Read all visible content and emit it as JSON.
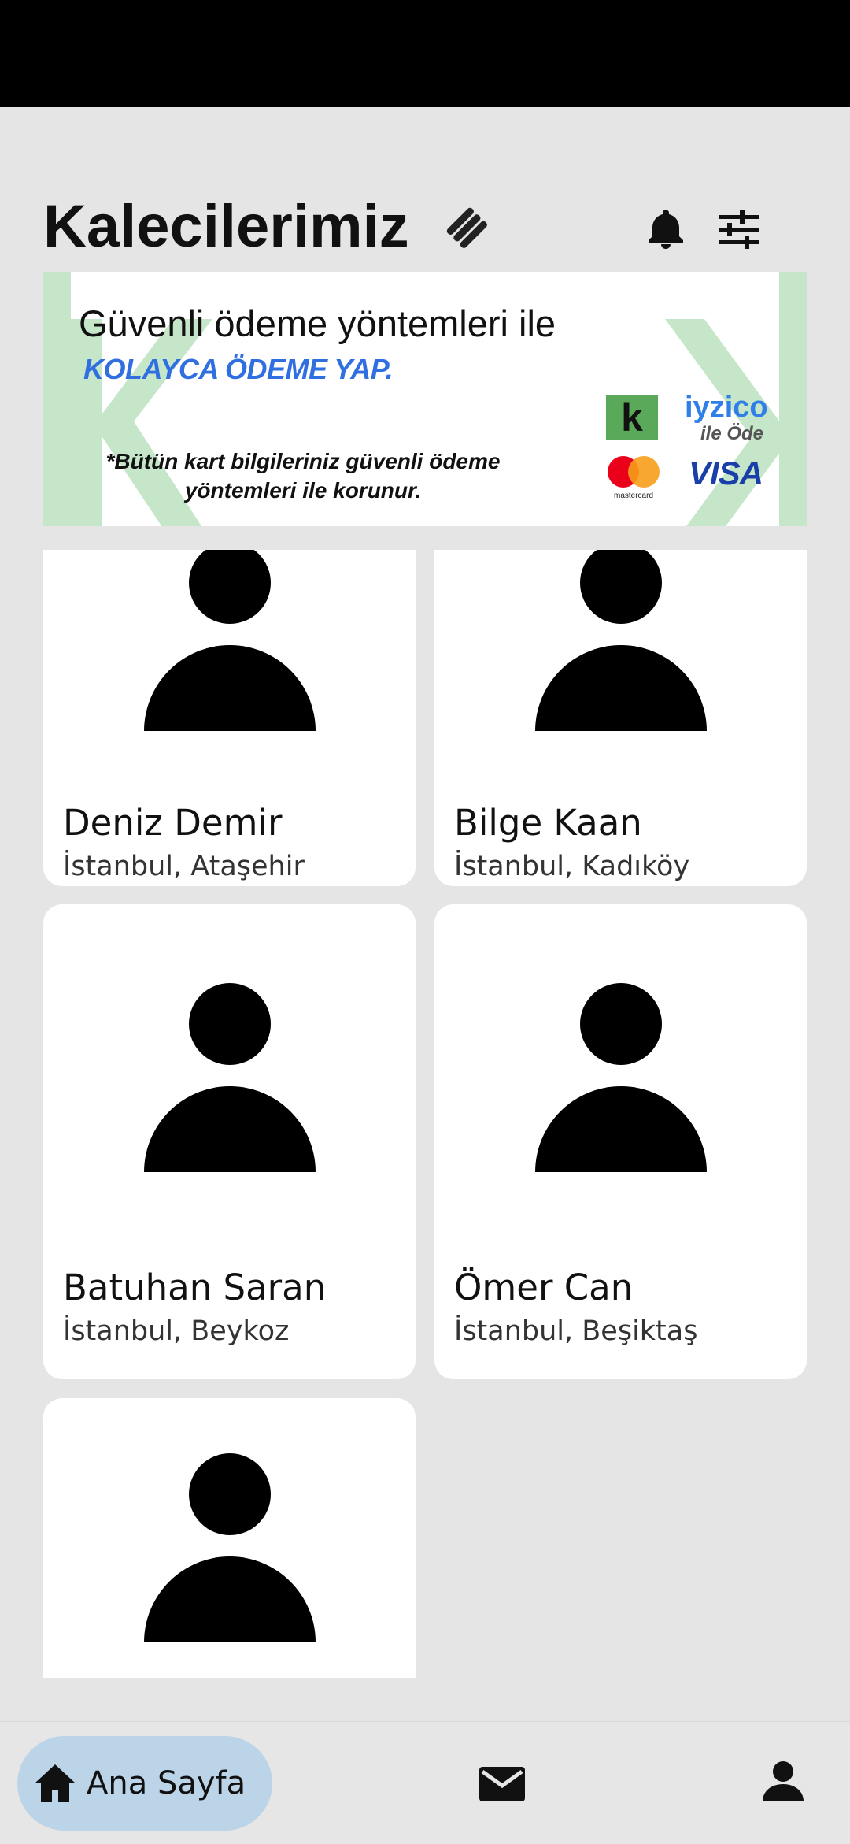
{
  "header": {
    "title": "Kalecilerimiz"
  },
  "banner": {
    "line1": "Güvenli ödeme yöntemleri ile",
    "line2": "KOLAYCA ÖDEME YAP.",
    "note": "*Bütün kart bilgileriniz güvenli ödeme yöntemleri ile korunur.",
    "logo_k": "k",
    "iyzico": "iyzico",
    "ile_ode": "ile Öde",
    "visa": "VISA",
    "mastercard": "mastercard"
  },
  "goalkeepers": [
    {
      "name": "Deniz Demir",
      "location": "İstanbul, Ataşehir"
    },
    {
      "name": "Bilge Kaan",
      "location": "İstanbul, Kadıköy"
    },
    {
      "name": "Batuhan Saran",
      "location": "İstanbul, Beykoz"
    },
    {
      "name": "Ömer Can",
      "location": "İstanbul, Beşiktaş"
    },
    {
      "name": "",
      "location": ""
    }
  ],
  "nav": {
    "home_label": "Ana Sayfa"
  },
  "colors": {
    "background": "#e5e5e5",
    "nav_active": "#bcd4e8",
    "banner_side": "#c6e6c9",
    "banner_accent": "#2f6fe0"
  },
  "icons": {
    "title": "hand-shake-icon",
    "notifications": "bell-icon",
    "filters": "sliders-icon",
    "home": "home-icon",
    "messages": "mail-icon",
    "profile": "person-icon"
  }
}
